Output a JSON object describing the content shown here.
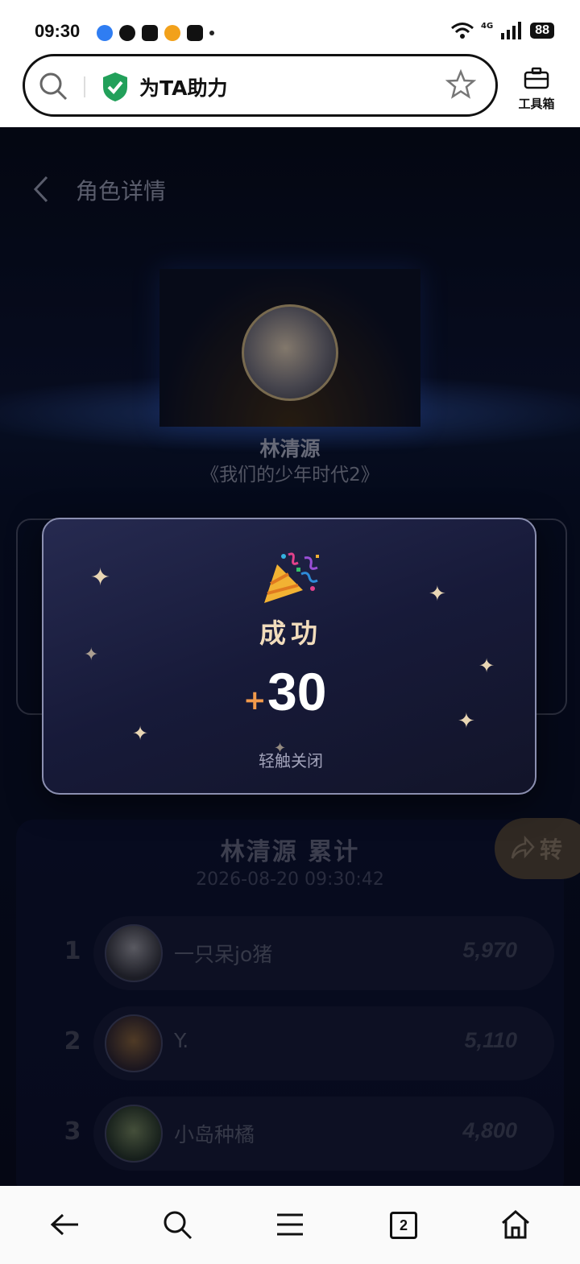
{
  "status_bar": {
    "time": "09:30",
    "network_label": "4G",
    "battery": "88"
  },
  "browser": {
    "url_title": "为TA助力",
    "toolbox_label": "工具箱",
    "tab_count": "2"
  },
  "page": {
    "title": "角色详情",
    "character_name": "林清源",
    "character_show": "《我们的少年时代2》"
  },
  "popup": {
    "title": "成功",
    "plus_sign": "+",
    "points": "30",
    "hint": "轻触关闭"
  },
  "ranking": {
    "title": "林清源 累计",
    "timestamp": "2026-08-20 09:30:42",
    "share_label": "转",
    "rows": [
      {
        "rank": "1",
        "name": "一只呆jo猪",
        "score": "5,970"
      },
      {
        "rank": "2",
        "name": "Y.",
        "score": "5,110"
      },
      {
        "rank": "3",
        "name": "小岛种橘",
        "score": "4,800"
      }
    ]
  },
  "colors": {
    "accent_gold": "#f1dcbc",
    "plus_orange": "#f29a4b",
    "shield_green": "#22a05a"
  },
  "icons": [
    "search-icon",
    "shield-check-icon",
    "star-icon",
    "toolbox-icon",
    "back-chevron-icon",
    "party-popper-icon",
    "sparkle-icon",
    "share-arrow-icon",
    "nav-back-icon",
    "nav-search-icon",
    "nav-menu-icon",
    "nav-home-icon"
  ]
}
